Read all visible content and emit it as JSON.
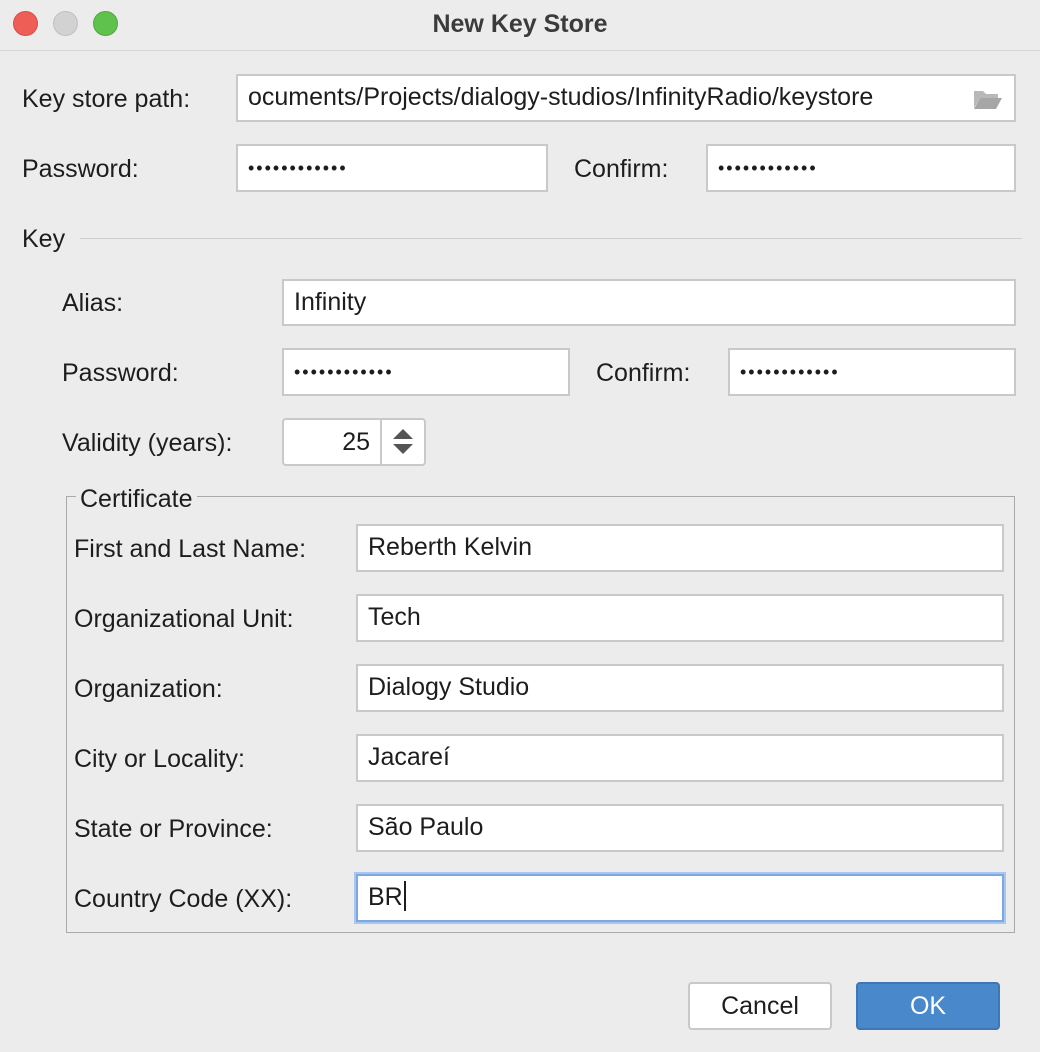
{
  "window": {
    "title": "New Key Store"
  },
  "keystore": {
    "path_label": "Key store path:",
    "path_value": "ocuments/Projects/dialogy-studios/InfinityRadio/keystore",
    "password_label": "Password:",
    "password_value": "••••••••••••",
    "confirm_label": "Confirm:",
    "confirm_value": "••••••••••••"
  },
  "key": {
    "section_label": "Key",
    "alias_label": "Alias:",
    "alias_value": "Infinity",
    "password_label": "Password:",
    "password_value": "••••••••••••",
    "confirm_label": "Confirm:",
    "confirm_value": "••••••••••••",
    "validity_label": "Validity (years):",
    "validity_value": "25"
  },
  "certificate": {
    "group_label": "Certificate",
    "fields": [
      {
        "label": "First and Last Name:",
        "value": "Reberth Kelvin"
      },
      {
        "label": "Organizational Unit:",
        "value": "Tech"
      },
      {
        "label": "Organization:",
        "value": "Dialogy Studio"
      },
      {
        "label": "City or Locality:",
        "value": "Jacareí"
      },
      {
        "label": "State or Province:",
        "value": "São Paulo"
      },
      {
        "label": "Country Code (XX):",
        "value": "BR"
      }
    ]
  },
  "buttons": {
    "cancel": "Cancel",
    "ok": "OK"
  },
  "icons": {
    "folder": "folder-open-icon",
    "spinner_up": "arrow-up-icon",
    "spinner_down": "arrow-down-icon"
  },
  "colors": {
    "accent": "#4a88cc",
    "focus": "#7da7e0"
  }
}
